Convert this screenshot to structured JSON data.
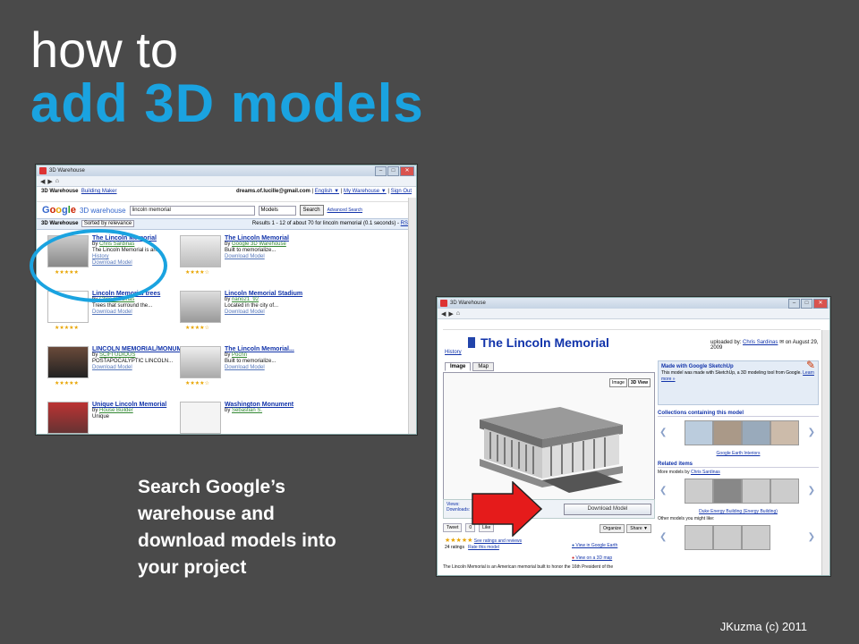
{
  "slide": {
    "title_line1": "how to",
    "title_line2": "add 3D models",
    "caption": "Search Google’s\nwarehouse and\ndownload models into\nyour project",
    "footer": "JKuzma (c) 2011",
    "accent_color": "#1aa3e0",
    "arrow_color": "#e51b1b"
  },
  "window1": {
    "title": "3D Warehouse",
    "nav_icons": [
      "back-icon",
      "forward-icon",
      "home-icon"
    ],
    "top_left_links": [
      "3D Warehouse",
      "Building Maker"
    ],
    "user_email": "dreams.of.lucille@gmail.com",
    "top_right_links": [
      "English ▼",
      "My Warehouse ▼",
      "Sign Out"
    ],
    "logo": {
      "google": "Google",
      "product": "3D warehouse"
    },
    "search_value": "lincoln memorial",
    "search_scope": "Models",
    "search_button": "Search",
    "advanced_search": "Advanced Search",
    "results_label": "3D Warehouse",
    "sort_label": "Sorted by relevance",
    "results_summary": "Results 1 - 12 of about 70 for lincoln memorial (0.1 seconds) -",
    "rss": "RSS",
    "results": [
      {
        "title": "The Lincoln Memorial",
        "by": "Chris Sardinas",
        "desc": "The Lincoln Memorial is an...",
        "extra": "History",
        "download": "Download Model",
        "stars": "★★★★★"
      },
      {
        "title": "The Lincoln Memorial",
        "by": "Google 3D Warehouse",
        "desc": "Built to memorialize...",
        "extra": "",
        "download": "Download Model",
        "stars": "★★★★☆"
      },
      {
        "title": "Lincoln Memorial trees",
        "by": "Chris Sardinas",
        "desc": "Trees that surround the...",
        "extra": "",
        "download": "Download Model",
        "stars": "★★★★★"
      },
      {
        "title": "Lincoln Memorial Stadium",
        "by": "nano21_92",
        "desc": "Located in the city of...",
        "extra": "",
        "download": "Download Model",
        "stars": "★★★★☆"
      },
      {
        "title": "LINCOLN MEMORIAL/MONUMENT...",
        "by": "SCIFI UDIOUS",
        "desc": "POSTAPOCALYPTIC LINCOLN...",
        "extra": "",
        "download": "Download Model",
        "stars": "★★★★★"
      },
      {
        "title": "The Lincoln Memorial...",
        "by": "Pochn",
        "desc": "Built to memorialize...",
        "extra": "",
        "download": "Download Model",
        "stars": "★★★★☆"
      },
      {
        "title": "Unique Lincoln Memorial",
        "by": "House Builder",
        "desc": "Unique",
        "extra": "",
        "download": "",
        "stars": ""
      },
      {
        "title": "Washington Monument",
        "by": "Sebastian S.",
        "desc": "",
        "extra": "",
        "download": "",
        "stars": ""
      }
    ]
  },
  "window2": {
    "title": "3D Warehouse",
    "model_title": "The Lincoln Memorial",
    "uploaded_prefix": "uploaded by:",
    "uploader": "Chris Sardinas",
    "uploaded_date": "on August 29, 2009",
    "history": "History",
    "tabs": [
      "Image",
      "Map"
    ],
    "view_buttons": [
      "Image",
      "3D View"
    ],
    "views_label": "Views:",
    "downloads_label": "Downloads:",
    "download_button": "Download Model",
    "tweet": "Tweet",
    "tweet_count": "0",
    "like": "Like",
    "organize": "Organize",
    "share": "Share ▼",
    "stars": "★★★★★",
    "ratings_count": "24 ratings",
    "see_ratings": "See ratings and reviews",
    "rate_model": "Rate this model",
    "view_google_earth": "View in Google Earth",
    "view_3d_map": "View on a 3D map",
    "description": "The Lincoln Memorial is an American memorial built to honor the 16th President of the",
    "made_with_title": "Made with Google SketchUp",
    "made_with_text": "This model was made with SketchUp, a 3D modeling tool from Google.",
    "learn_more": "Learn more »",
    "collections_heading": "Collections containing this model",
    "collection_label": "Google Earth Interiors",
    "related_heading": "Related items",
    "more_models_prefix": "More models by",
    "more_models_author": "Chris Sardinas",
    "related_label": "Duke Energy Building (Energy Building)",
    "other_models": "Other models you might like:"
  }
}
